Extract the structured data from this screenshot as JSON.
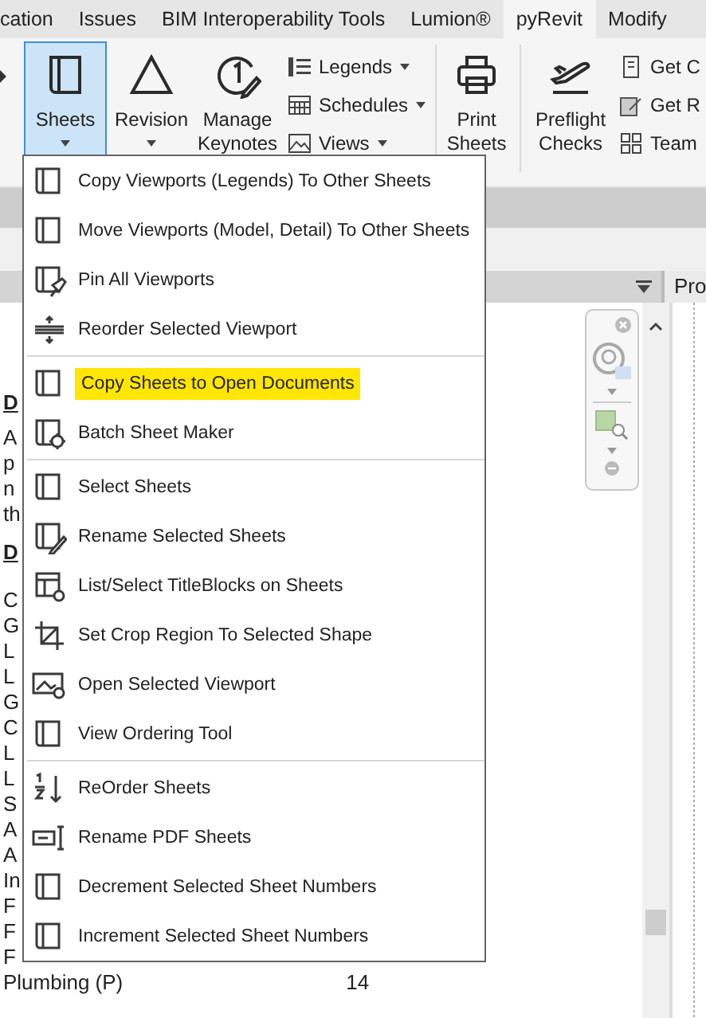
{
  "tabs": [
    {
      "label": "cation",
      "selected": false
    },
    {
      "label": "Issues",
      "selected": false
    },
    {
      "label": "BIM Interoperability Tools",
      "selected": false
    },
    {
      "label": "Lumion®",
      "selected": false
    },
    {
      "label": "pyRevit",
      "selected": true
    },
    {
      "label": "Modify",
      "selected": false
    }
  ],
  "ribbon": {
    "large_buttons": [
      {
        "label": "Sheets",
        "selected": true,
        "dropdown": true
      },
      {
        "label": "Revision",
        "selected": false,
        "dropdown": true
      },
      {
        "label": "Manage Keynotes",
        "selected": false,
        "dropdown": false
      }
    ],
    "stack": [
      {
        "label": "Legends",
        "dropdown": true
      },
      {
        "label": "Schedules",
        "dropdown": true
      },
      {
        "label": "Views",
        "dropdown": true
      }
    ],
    "print": {
      "label": "Print Sheets"
    },
    "preflight": {
      "label": "Preflight Checks"
    },
    "stack_2": [
      {
        "label": "Get C"
      },
      {
        "label": "Get R"
      },
      {
        "label": "Team"
      }
    ]
  },
  "view_header": {
    "panel_label": "Pro"
  },
  "document": {
    "lines": [
      {
        "kind": "heading",
        "text": "D"
      },
      {
        "kind": "line",
        "text": "A"
      },
      {
        "kind": "line",
        "text": "p"
      },
      {
        "kind": "line",
        "text": "n"
      },
      {
        "kind": "line",
        "text": "th"
      },
      {
        "kind": "heading",
        "text": "D"
      },
      {
        "kind": "line",
        "text": "C"
      },
      {
        "kind": "line",
        "text": "G"
      },
      {
        "kind": "line",
        "text": "L"
      },
      {
        "kind": "line",
        "text": "L"
      },
      {
        "kind": "line",
        "text": "G"
      },
      {
        "kind": "line",
        "text": "C"
      },
      {
        "kind": "line",
        "text": "L"
      },
      {
        "kind": "line",
        "text": "L"
      },
      {
        "kind": "line",
        "text": "S"
      },
      {
        "kind": "line",
        "text": "A"
      },
      {
        "kind": "line",
        "text": "A"
      },
      {
        "kind": "line",
        "text": "In"
      },
      {
        "kind": "line",
        "text": "F"
      },
      {
        "kind": "line",
        "text": "F"
      },
      {
        "kind": "line",
        "text": "F"
      }
    ],
    "last_row": {
      "label": "Plumbing (P)",
      "value": "14"
    }
  },
  "menu": {
    "groups": [
      [
        {
          "label": "Copy Viewports (Legends) To Other Sheets",
          "highlighted": false
        },
        {
          "label": "Move Viewports (Model, Detail) To Other Sheets",
          "highlighted": false
        },
        {
          "label": "Pin All Viewports",
          "highlighted": false
        },
        {
          "label": "Reorder Selected Viewport",
          "highlighted": false
        }
      ],
      [
        {
          "label": "Copy Sheets to Open Documents",
          "highlighted": true
        },
        {
          "label": "Batch Sheet Maker",
          "highlighted": false
        }
      ],
      [
        {
          "label": "Select Sheets",
          "highlighted": false
        },
        {
          "label": "Rename Selected Sheets",
          "highlighted": false
        },
        {
          "label": "List/Select TitleBlocks on Sheets",
          "highlighted": false
        },
        {
          "label": "Set Crop Region To Selected Shape",
          "highlighted": false
        },
        {
          "label": "Open Selected Viewport",
          "highlighted": false
        },
        {
          "label": "View Ordering Tool",
          "highlighted": false
        }
      ],
      [
        {
          "label": "ReOrder Sheets",
          "highlighted": false
        },
        {
          "label": "Rename PDF Sheets",
          "highlighted": false
        },
        {
          "label": "Decrement Selected Sheet Numbers",
          "highlighted": false
        },
        {
          "label": "Increment Selected Sheet Numbers",
          "highlighted": false
        }
      ]
    ]
  }
}
